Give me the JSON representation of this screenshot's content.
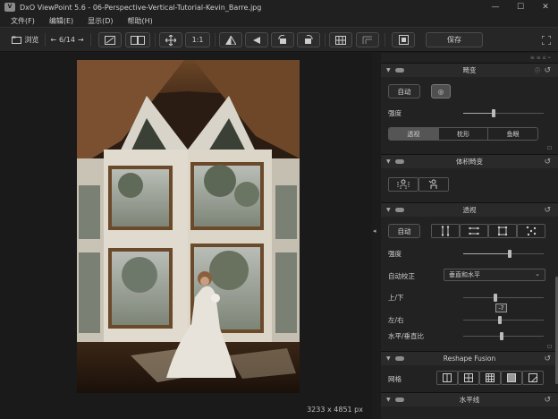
{
  "window": {
    "logo_text": "V",
    "title": "DxO ViewPoint 5.6 - 06-Perspective-Vertical-Tutorial-Kevin_Barre.jpg",
    "controls": [
      "—",
      "☐",
      "✕"
    ]
  },
  "menu": [
    "文件(F)",
    "编辑(E)",
    "显示(D)",
    "帮助(H)"
  ],
  "toolbar": {
    "browse_label": "浏览",
    "nav_counter": "6/14",
    "prev_glyph": "←",
    "next_glyph": "→",
    "zoom_label": "1:1",
    "save_label": "保存"
  },
  "viewer": {
    "image_size": "3233 x 4851 px"
  },
  "panel": {
    "top_tools": "≡ ≡ ⌂ ⌁",
    "sections": {
      "lens": {
        "title": "畸变",
        "auto_label": "自动",
        "auto_glyph": "◎",
        "intensity_label": "强度",
        "intensity_value": 0.38,
        "modes": [
          "透视",
          "枕形",
          "鱼眼"
        ],
        "active_mode": 0
      },
      "volume": {
        "title": "体积畸变"
      },
      "perspective": {
        "title": "透视",
        "auto_label": "自动",
        "intensity_label": "强度",
        "intensity_value": 0.58,
        "auto_correct_label": "自动校正",
        "auto_correct_value": "垂直和水平",
        "vertical_label": "上/下",
        "vertical_value": 0.4,
        "vertical_readout": "-7",
        "horizontal_label": "左/右",
        "horizontal_value": 0.45,
        "ratio_label": "水平/垂直比",
        "ratio_value": 0.48
      },
      "reshape": {
        "title": "Reshape Fusion",
        "grid_label": "网格"
      },
      "horizon": {
        "title": "水平线"
      }
    },
    "reset_glyph": "↺"
  },
  "colors": {
    "panel_bg": "#222222",
    "section_header": "#2a2a2a",
    "active_button": "#4f4f4f"
  }
}
